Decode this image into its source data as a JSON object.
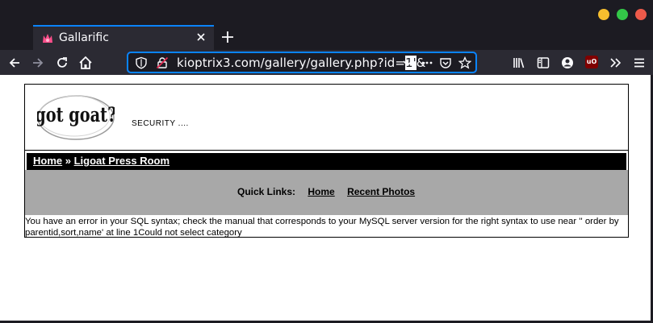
{
  "browser": {
    "tab_title": "Gallarific",
    "url_prefix": "kioptrix3.com/gallery/gallery.php?id=",
    "url_selected": "1'",
    "url_suffix": "&"
  },
  "page": {
    "logo_text": "got goat?",
    "tagline": "SECURITY ....",
    "breadcrumb": {
      "home": "Home",
      "separator": " » ",
      "current": "Ligoat Press Room"
    },
    "quick_links": {
      "label": "Quick Links:",
      "home": "Home",
      "recent_photos": "Recent Photos"
    },
    "error_message": "You have an error in your SQL syntax; check the manual that corresponds to your MySQL server version for the right syntax to use near '' order by parentid,sort,name' at line 1Could not select category"
  },
  "colors": {
    "chrome_dark": "#1c1b22",
    "chrome_toolbar": "#2b2a33",
    "focus_blue": "#0a84ff",
    "breadcrumb_bg": "#000000",
    "quicklinks_bg": "#a8a8a8"
  }
}
